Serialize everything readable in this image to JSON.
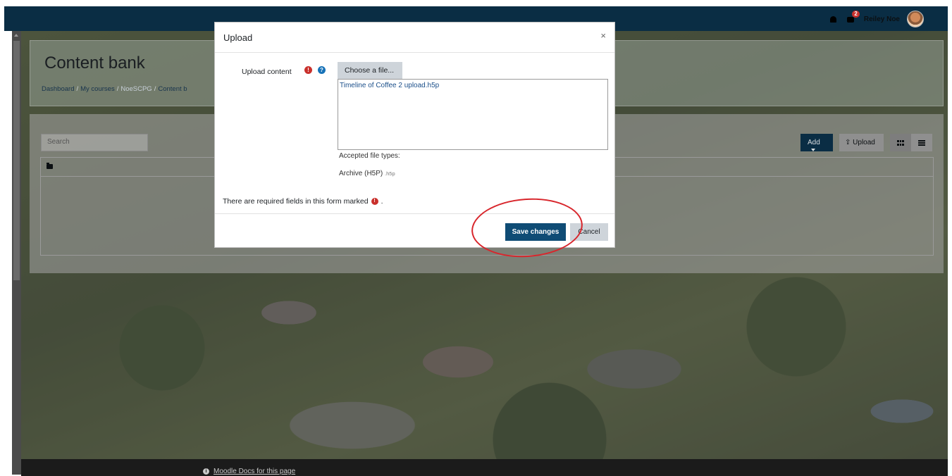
{
  "navbar": {
    "user_name": "Reiley Noe",
    "messages_badge": "2",
    "icons": [
      "bell-icon",
      "message-icon"
    ]
  },
  "page": {
    "title": "Content bank",
    "breadcrumb": [
      "Dashboard",
      "My courses",
      "NoeSCPG",
      "Content b"
    ]
  },
  "content_bank": {
    "search_placeholder": "Search",
    "add_label": "Add",
    "upload_label": "Upload"
  },
  "modal": {
    "title": "Upload",
    "close_label": "×",
    "upload_content_label": "Upload content",
    "choose_file_label": "Choose a file...",
    "file_name": "Timeline of Coffee 2 upload.h5p",
    "accepted_label": "Accepted file types:",
    "accepted_type_name": "Archive (H5P)",
    "accepted_type_ext": ".h5p",
    "required_note": "There are required fields in this form marked",
    "required_note_end": ".",
    "save_label": "Save changes",
    "cancel_label": "Cancel"
  },
  "footer": {
    "docs_link": "Moodle Docs for this page"
  },
  "colors": {
    "navbar": "#0a2d44",
    "primary_button": "#0f4c75",
    "required": "#c9302c",
    "help": "#1772b8",
    "annotation": "#d8262c"
  }
}
